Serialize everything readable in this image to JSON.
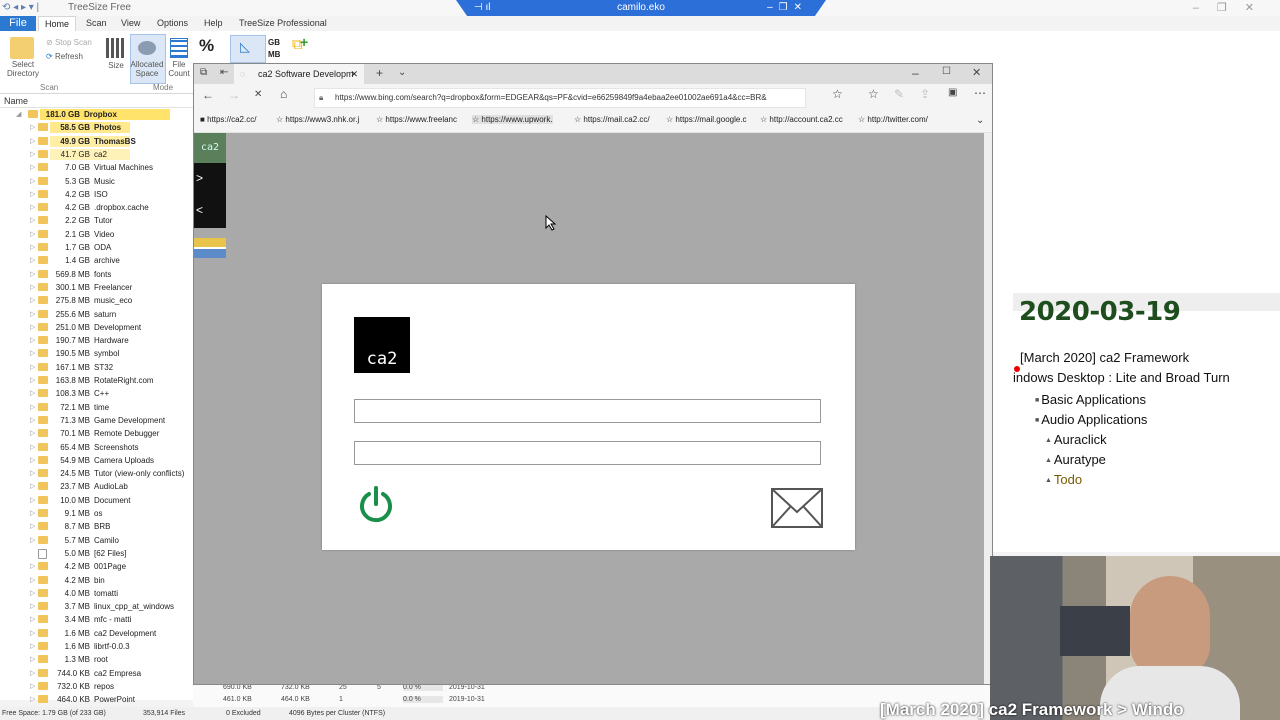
{
  "treesize": {
    "title": "TreeSize Free",
    "menu": [
      "File",
      "Home",
      "Scan",
      "View",
      "Options",
      "Help",
      "TreeSize Professional"
    ],
    "ribbon": {
      "select_directory": "Select\nDirectory",
      "stop_scan": "Stop Scan",
      "refresh": "Refresh",
      "size": "Size",
      "allocated_space": "Allocated\nSpace",
      "file_count": "File\nCount",
      "percent": "%",
      "gb": "GB",
      "mb": "MB",
      "group_scan": "Scan",
      "group_mode": "Mode"
    },
    "column_name": "Name",
    "rows": [
      {
        "size": "181.0 GB",
        "name": "Dropbox",
        "level": 0,
        "hl": "#ffe36b",
        "bold": true
      },
      {
        "size": "58.5 GB",
        "name": "Photos",
        "level": 1,
        "hl": "#ffe98c",
        "bold": true
      },
      {
        "size": "49.9 GB",
        "name": "ThomasBS",
        "level": 1,
        "hl": "#ffeea4",
        "bold": true
      },
      {
        "size": "41.7 GB",
        "name": "ca2",
        "level": 1,
        "hl": "#fff2b8",
        "bold": false
      },
      {
        "size": "7.0 GB",
        "name": "Virtual Machines",
        "level": 2
      },
      {
        "size": "5.3 GB",
        "name": "Music",
        "level": 2
      },
      {
        "size": "4.2 GB",
        "name": "ISO",
        "level": 2
      },
      {
        "size": "4.2 GB",
        "name": ".dropbox.cache",
        "level": 2
      },
      {
        "size": "2.2 GB",
        "name": "Tutor",
        "level": 2
      },
      {
        "size": "2.1 GB",
        "name": "Video",
        "level": 2
      },
      {
        "size": "1.7 GB",
        "name": "ODA",
        "level": 2
      },
      {
        "size": "1.4 GB",
        "name": "archive",
        "level": 2
      },
      {
        "size": "569.8 MB",
        "name": "fonts",
        "level": 2
      },
      {
        "size": "300.1 MB",
        "name": "Freelancer",
        "level": 2
      },
      {
        "size": "275.8 MB",
        "name": "music_eco",
        "level": 2
      },
      {
        "size": "255.6 MB",
        "name": "saturn",
        "level": 2
      },
      {
        "size": "251.0 MB",
        "name": "Development",
        "level": 2
      },
      {
        "size": "190.7 MB",
        "name": "Hardware",
        "level": 2
      },
      {
        "size": "190.5 MB",
        "name": "symbol",
        "level": 2
      },
      {
        "size": "167.1 MB",
        "name": "ST32",
        "level": 2
      },
      {
        "size": "163.8 MB",
        "name": "RotateRight.com",
        "level": 2
      },
      {
        "size": "108.3 MB",
        "name": "C++",
        "level": 2
      },
      {
        "size": "72.1 MB",
        "name": "time",
        "level": 2
      },
      {
        "size": "71.3 MB",
        "name": "Game Development",
        "level": 2
      },
      {
        "size": "70.1 MB",
        "name": "Remote Debugger",
        "level": 2
      },
      {
        "size": "65.4 MB",
        "name": "Screenshots",
        "level": 2
      },
      {
        "size": "54.9 MB",
        "name": "Camera Uploads",
        "level": 2
      },
      {
        "size": "24.5 MB",
        "name": "Tutor (view-only conflicts)",
        "level": 2
      },
      {
        "size": "23.7 MB",
        "name": "AudioLab",
        "level": 2
      },
      {
        "size": "10.0 MB",
        "name": "Document",
        "level": 2
      },
      {
        "size": "9.1 MB",
        "name": "os",
        "level": 2
      },
      {
        "size": "8.7 MB",
        "name": "BRB",
        "level": 2
      },
      {
        "size": "5.7 MB",
        "name": "Camilo",
        "level": 2
      },
      {
        "size": "5.0 MB",
        "name": "[62 Files]",
        "level": 2,
        "file": true
      },
      {
        "size": "4.2 MB",
        "name": "001Page",
        "level": 2
      },
      {
        "size": "4.2 MB",
        "name": "bin",
        "level": 2
      },
      {
        "size": "4.0 MB",
        "name": "tomatti",
        "level": 2
      },
      {
        "size": "3.7 MB",
        "name": "linux_cpp_at_windows",
        "level": 2
      },
      {
        "size": "3.4 MB",
        "name": "mfc - matti",
        "level": 2
      },
      {
        "size": "1.6 MB",
        "name": "ca2 Development",
        "level": 2
      },
      {
        "size": "1.6 MB",
        "name": "librtf-0.0.3",
        "level": 2
      },
      {
        "size": "1.3 MB",
        "name": "root",
        "level": 2
      },
      {
        "size": "744.0 KB",
        "name": "ca2 Empresa",
        "level": 2
      },
      {
        "size": "732.0 KB",
        "name": "repos",
        "level": 2
      },
      {
        "size": "464.0 KB",
        "name": "PowerPoint",
        "level": 2
      }
    ],
    "bottom_row": {
      "a": "690.0 KB",
      "b": "732.0 KB",
      "c": "25",
      "d": "5",
      "e": "0.0 %",
      "f": "2019-10-31"
    },
    "bottom_row2": {
      "a": "461.0 KB",
      "b": "464.0 KB",
      "c": "1",
      "d": "",
      "e": "0.0 %",
      "f": "2019-10-31"
    },
    "status": {
      "free_space": "Free Space: 1.79 GB (of 233 GB)",
      "files": "353,914 Files",
      "excluded": "0 Excluded",
      "cluster": "4096 Bytes per Cluster (NTFS)"
    }
  },
  "remote": {
    "title": "camilo.eko"
  },
  "browser": {
    "tab_title": "ca2 Software Developm",
    "url": "https://www.bing.com/search?q=dropbox&form=EDGEAR&qs=PF&cvid=e66259849f9a4ebaa2ee01002ae691a4&cc=BR&",
    "favorites": [
      "https://ca2.cc/",
      "https://www3.nhk.or.j",
      "https://www.freelanc",
      "https://www.upwork.",
      "https://mail.ca2.cc/",
      "https://mail.google.c",
      "http://account.ca2.cc",
      "http://twitter.com/"
    ],
    "side_logo": "ca2",
    "side_next": ">",
    "side_prev": "<",
    "logo_text": "ca2"
  },
  "slide": {
    "date": "2020-03-19",
    "heading": "[March 2020] ca2 Framework",
    "line2": "indows Desktop : Lite and Broad Turn",
    "items": [
      {
        "text": "Basic Applications",
        "bullet": "■"
      },
      {
        "text": "Audio Applications",
        "bullet": "■"
      },
      {
        "text": "Auraclick",
        "bullet": "▲"
      },
      {
        "text": "Auratype",
        "bullet": "▲"
      },
      {
        "text": "Todo",
        "bullet": "▲"
      }
    ],
    "colors": {
      "date": "#1e4d1e",
      "todo": "#7a5a00"
    }
  },
  "caption": "[March 2020] ca2 Framework > Windo"
}
